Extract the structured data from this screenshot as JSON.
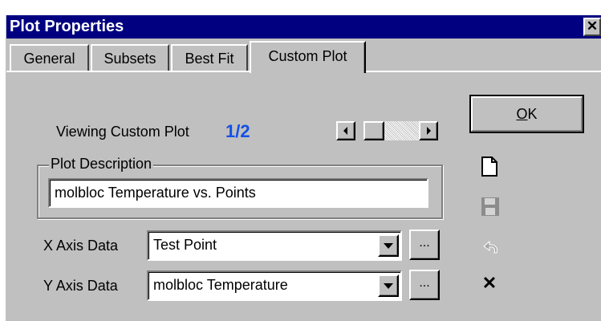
{
  "window": {
    "title": "Plot Properties",
    "close_glyph": "✕"
  },
  "tabs": [
    {
      "label": "General"
    },
    {
      "label": "Subsets"
    },
    {
      "label": "Best Fit"
    },
    {
      "label": "Custom Plot",
      "active": true
    }
  ],
  "viewer": {
    "label": "Viewing Custom Plot",
    "counter": "1/2",
    "counter_color": "#1450e6"
  },
  "description": {
    "legend": "Plot Description",
    "value": "molbloc Temperature vs. Points"
  },
  "x_axis": {
    "label": "X Axis Data",
    "value": "Test Point",
    "browse_label": "..."
  },
  "y_axis": {
    "label": "Y Axis Data",
    "value": "molbloc Temperature",
    "browse_label": "..."
  },
  "buttons": {
    "ok_accel": "O",
    "ok_rest": "K"
  },
  "toolbar": {
    "icons": [
      "new-document-icon",
      "save-icon",
      "undo-icon",
      "delete-icon"
    ],
    "delete_glyph": "✕"
  }
}
